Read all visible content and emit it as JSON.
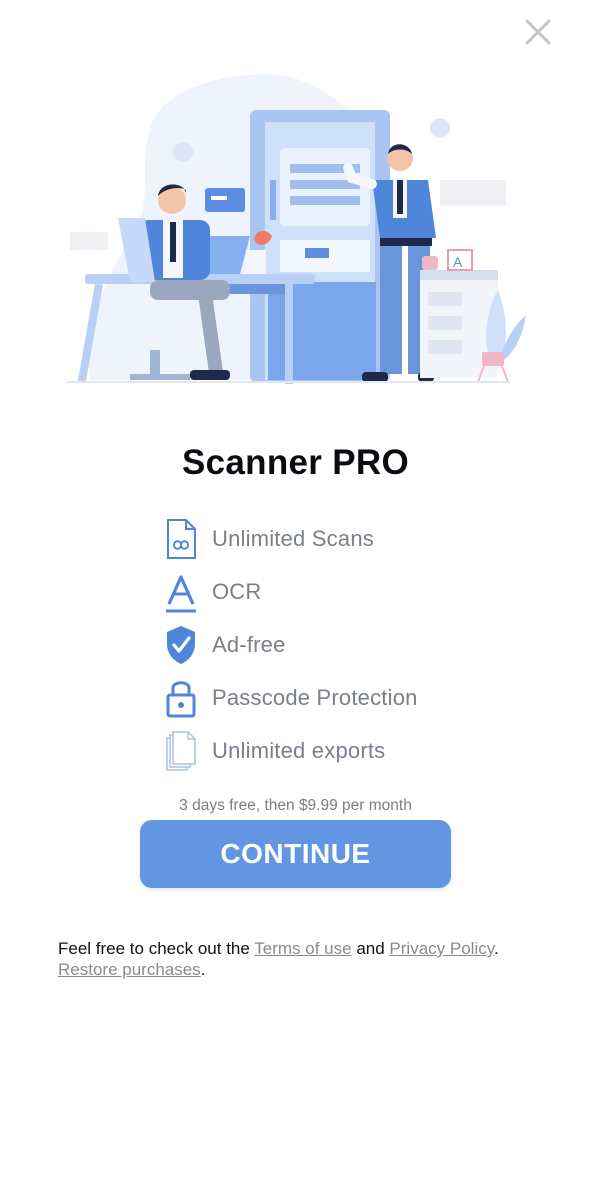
{
  "header": {
    "close_icon": "close-icon"
  },
  "hero": {
    "illustration": "office-document-scanner-illustration"
  },
  "title": "Scanner PRO",
  "features": [
    {
      "label": "Unlimited Scans",
      "icon": "infinity-document-icon"
    },
    {
      "label": "OCR",
      "icon": "text-a-icon"
    },
    {
      "label": "Ad-free",
      "icon": "shield-check-icon"
    },
    {
      "label": "Passcode Protection",
      "icon": "lock-icon"
    },
    {
      "label": "Unlimited exports",
      "icon": "stacked-pages-icon"
    }
  ],
  "trial_text": "3 days free, then $9.99 per month",
  "continue_label": "CONTINUE",
  "legal": {
    "prefix": "Feel free to check out the",
    "terms_link": "Terms of use",
    "and": "and",
    "privacy_link": "Privacy Policy",
    "restore_link": "Restore purchases"
  },
  "colors": {
    "accent": "#6396e2",
    "icon_blue": "#4f86d9",
    "feature_text": "#7a7f8a",
    "close_icon": "#c4c4c8"
  }
}
